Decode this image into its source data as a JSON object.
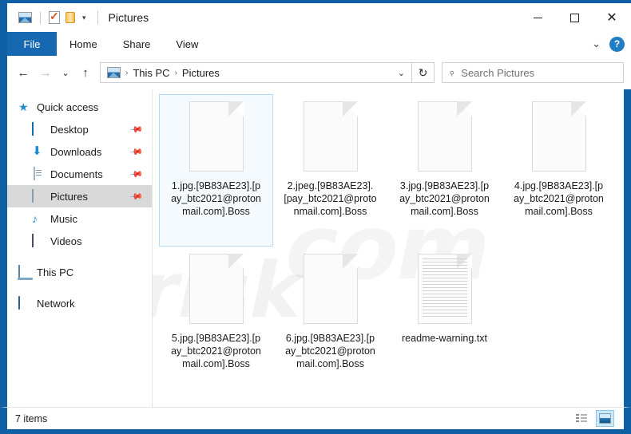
{
  "window": {
    "title": "Pictures",
    "quick_access_icons": [
      "pictures-icon",
      "properties-icon",
      "new-folder-icon",
      "customize-chevron-icon"
    ],
    "controls": {
      "minimize": "–",
      "maximize": "□",
      "close": "✕"
    }
  },
  "ribbon": {
    "tabs": [
      {
        "label": "File",
        "active": true
      },
      {
        "label": "Home",
        "active": false
      },
      {
        "label": "Share",
        "active": false
      },
      {
        "label": "View",
        "active": false
      }
    ],
    "expand_label": "⌄",
    "help_label": "?"
  },
  "address": {
    "back": "←",
    "forward": "→",
    "recent": "⌄",
    "up": "↑",
    "crumbs": [
      "This PC",
      "Pictures"
    ],
    "separator": "›",
    "dropdown": "⌄",
    "refresh": "↻"
  },
  "search": {
    "placeholder": "Search Pictures",
    "icon": "search-icon"
  },
  "sidebar": {
    "items": [
      {
        "label": "Quick access",
        "icon": "star-icon",
        "level": "group",
        "pinned": false,
        "selected": false
      },
      {
        "label": "Desktop",
        "icon": "desktop-icon",
        "level": "child",
        "pinned": true,
        "selected": false
      },
      {
        "label": "Downloads",
        "icon": "downloads-icon",
        "level": "child",
        "pinned": true,
        "selected": false
      },
      {
        "label": "Documents",
        "icon": "documents-icon",
        "level": "child",
        "pinned": true,
        "selected": false
      },
      {
        "label": "Pictures",
        "icon": "pictures-icon",
        "level": "child",
        "pinned": true,
        "selected": true
      },
      {
        "label": "Music",
        "icon": "music-icon",
        "level": "child",
        "pinned": false,
        "selected": false
      },
      {
        "label": "Videos",
        "icon": "videos-icon",
        "level": "child",
        "pinned": false,
        "selected": false
      },
      {
        "label": "This PC",
        "icon": "this-pc-icon",
        "level": "group",
        "pinned": false,
        "selected": false
      },
      {
        "label": "Network",
        "icon": "network-icon",
        "level": "group",
        "pinned": false,
        "selected": false
      }
    ],
    "pin_glyph": "📌"
  },
  "files": [
    {
      "name": "1.jpg.[9B83AE23].[pay_btc2021@protonmail.com].Boss",
      "icon": "blank-file-icon",
      "selected": true
    },
    {
      "name": "2.jpeg.[9B83AE23].[pay_btc2021@protonmail.com].Boss",
      "icon": "blank-file-icon",
      "selected": false
    },
    {
      "name": "3.jpg.[9B83AE23].[pay_btc2021@protonmail.com].Boss",
      "icon": "blank-file-icon",
      "selected": false
    },
    {
      "name": "4.jpg.[9B83AE23].[pay_btc2021@protonmail.com].Boss",
      "icon": "blank-file-icon",
      "selected": false
    },
    {
      "name": "5.jpg.[9B83AE23].[pay_btc2021@protonmail.com].Boss",
      "icon": "blank-file-icon",
      "selected": false
    },
    {
      "name": "6.jpg.[9B83AE23].[pay_btc2021@protonmail.com].Boss",
      "icon": "blank-file-icon",
      "selected": false
    },
    {
      "name": "readme-warning.txt",
      "icon": "text-file-icon",
      "selected": false
    }
  ],
  "watermark": {
    "text": "risk",
    "text2": "com"
  },
  "statusbar": {
    "item_count": "7 items",
    "views": [
      {
        "name": "details-view-button",
        "active": false
      },
      {
        "name": "large-icons-view-button",
        "active": true
      }
    ]
  },
  "colors": {
    "window_border": "#0e5fa4",
    "file_tab": "#1668b0",
    "selection": "#d9d9d9",
    "item_selected_border": "#b6dcf5",
    "accent": "#1f8ad2"
  }
}
